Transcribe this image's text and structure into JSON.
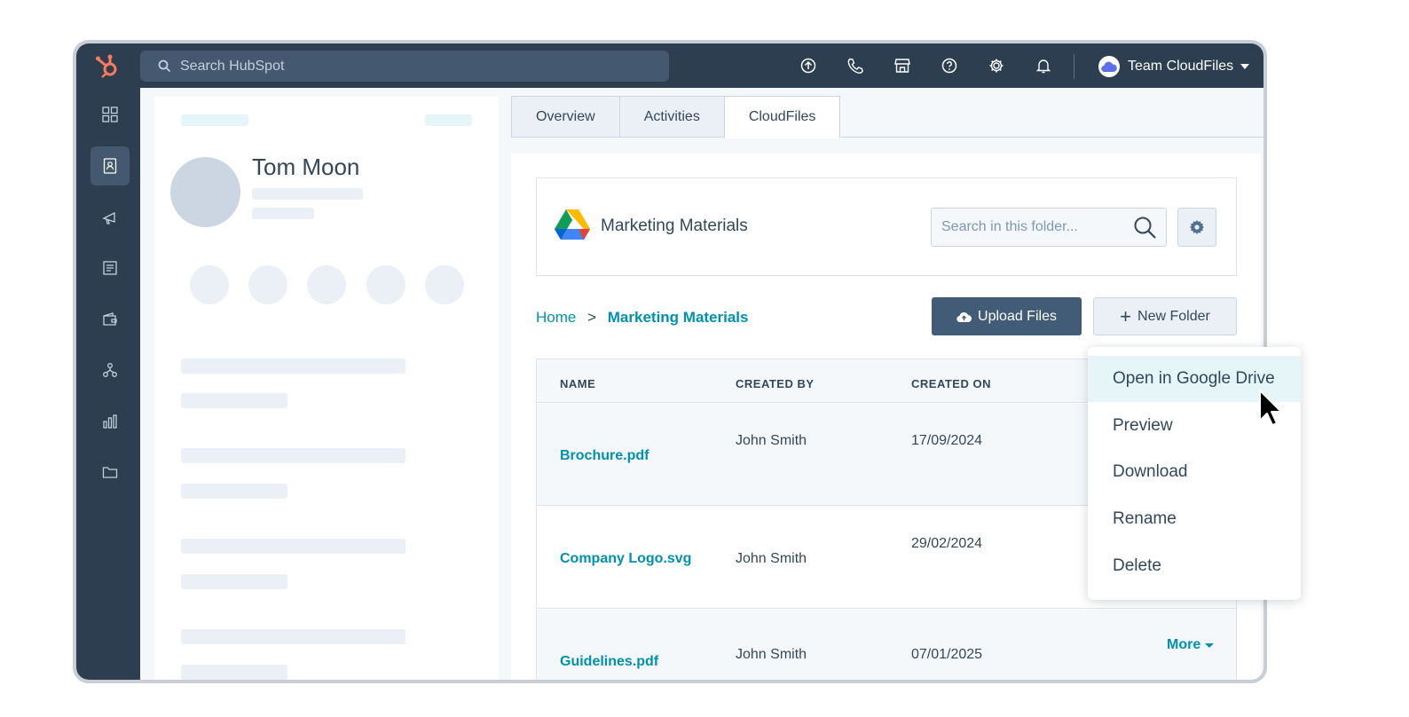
{
  "topbar": {
    "search_placeholder": "Search HubSpot",
    "icons": [
      "upgrade-icon",
      "phone-icon",
      "marketplace-icon",
      "help-icon",
      "settings-icon",
      "notifications-icon"
    ],
    "account_name": "Team CloudFiles"
  },
  "sidebar": {
    "items": [
      "dashboard-icon",
      "contacts-icon",
      "marketing-icon",
      "content-icon",
      "commerce-icon",
      "automation-icon",
      "reporting-icon",
      "files-icon"
    ],
    "active": "contacts-icon"
  },
  "contact": {
    "name": "Tom Moon"
  },
  "tabs": [
    {
      "label": "Overview",
      "active": false
    },
    {
      "label": "Activities",
      "active": false
    },
    {
      "label": "CloudFiles",
      "active": true
    }
  ],
  "folder": {
    "title": "Marketing Materials",
    "search_placeholder": "Search in this folder...",
    "breadcrumb": {
      "home": "Home",
      "separator": ">",
      "current": "Marketing Materials"
    },
    "upload_label": "Upload Files",
    "new_folder_label": "New Folder"
  },
  "table": {
    "columns": [
      "NAME",
      "CREATED BY",
      "CREATED ON"
    ],
    "rows": [
      {
        "name": "Brochure.pdf",
        "created_by": "John Smith",
        "created_on": "17/09/2024"
      },
      {
        "name": "Company Logo.svg",
        "created_by": "John Smith",
        "created_on": "29/02/2024"
      },
      {
        "name": "Guidelines.pdf",
        "created_by": "John Smith",
        "created_on": "07/01/2025"
      }
    ],
    "more_label": "More"
  },
  "context_menu": {
    "items": [
      "Open in Google Drive",
      "Preview",
      "Download",
      "Rename",
      "Delete"
    ],
    "highlighted": "Open in Google Drive"
  },
  "colors": {
    "nav_dark": "#2d3e50",
    "link": "#0091ae",
    "primary_button": "#425b76",
    "hubspot_orange": "#ff7a59"
  }
}
